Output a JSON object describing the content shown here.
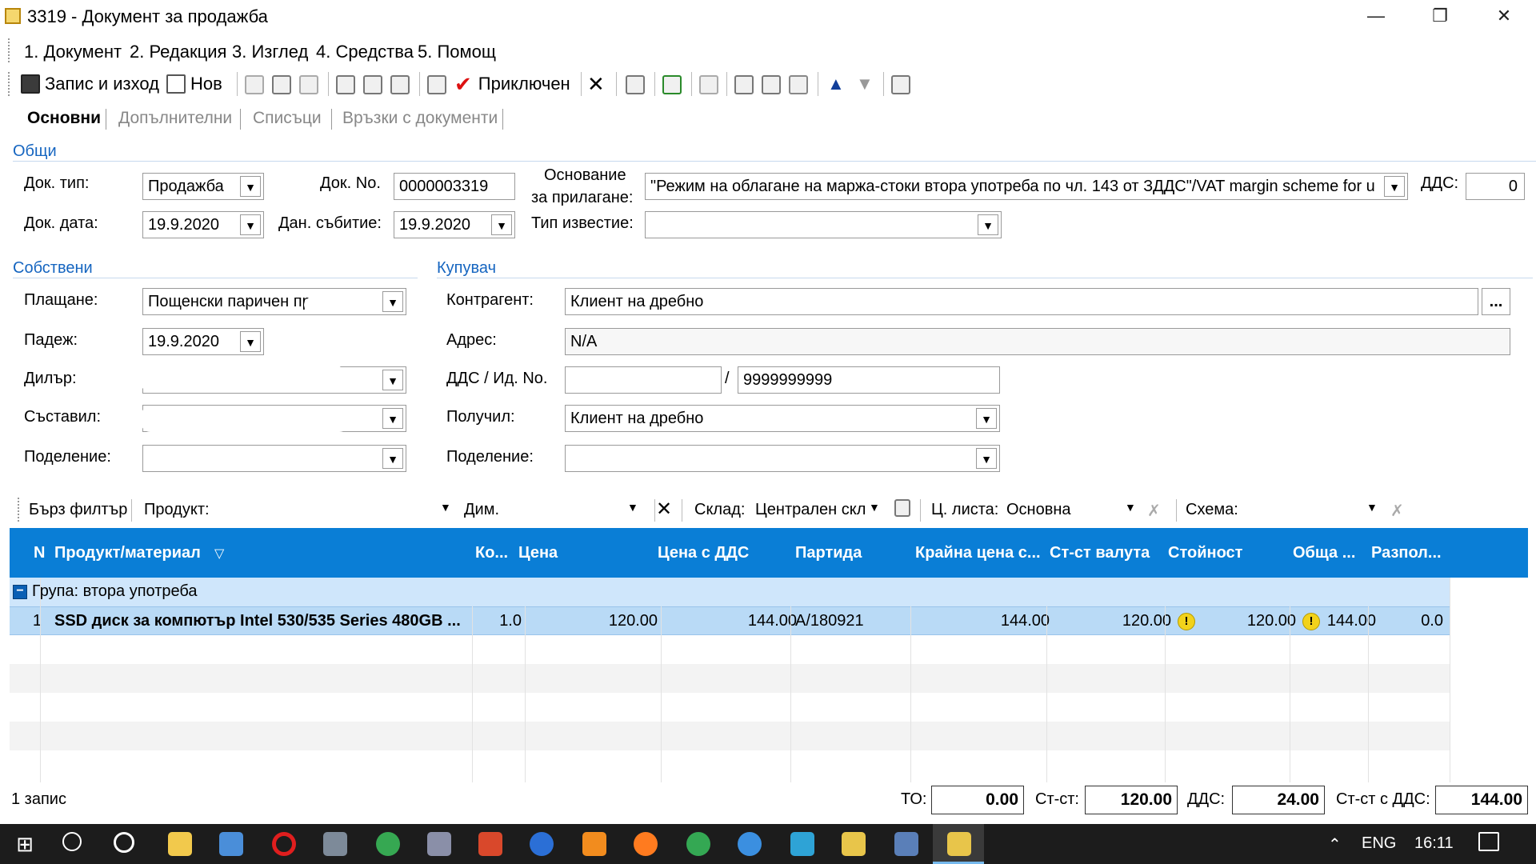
{
  "window": {
    "title": "3319 - Документ за продажба"
  },
  "menu": [
    "1. Документ",
    "2. Редакция",
    "3. Изглед",
    "4. Средства",
    "5. Помощ"
  ],
  "toolbar": {
    "save_exit": "Запис и изход",
    "new": "Нов",
    "completed": "Приключен"
  },
  "tabs": [
    "Основни",
    "Допълнителни",
    "Списъци",
    "Връзки с документи"
  ],
  "general": {
    "section": "Общи",
    "doc_type_label": "Док. тип:",
    "doc_type": "Продажба",
    "doc_no_label": "Док. No.",
    "doc_no": "0000003319",
    "basis_label_1": "Основание",
    "basis_label_2": "за прилагане:",
    "basis": "\"Режим на облагане на маржа-стоки втора употреба по чл. 143 от ЗДДС\"/VAT margin scheme for u",
    "vat_label": "ДДС:",
    "vat": "0",
    "doc_date_label": "Док. дата:",
    "doc_date": "19.9.2020",
    "tax_event_label": "Дан. събитие:",
    "tax_event": "19.9.2020",
    "notice_type_label": "Тип известие:",
    "notice_type": ""
  },
  "own": {
    "section": "Собствени",
    "payment_label": "Плащане:",
    "payment": "Пощенски паричен превод",
    "due_label": "Падеж:",
    "due": "19.9.2020",
    "dealer_label": "Дилър:",
    "dealer": "",
    "compiler_label": "Съставил:",
    "compiler": "",
    "division_label": "Поделение:",
    "division": ""
  },
  "buyer": {
    "section": "Купувач",
    "partner_label": "Контрагент:",
    "partner": "Клиент на дребно",
    "partner_btn": "...",
    "address_label": "Адрес:",
    "address": "N/A",
    "vat_id_label": "ДДС / Ид. No.",
    "vat_no": "",
    "id_no": "9999999999",
    "sep": "/",
    "received_label": "Получил:",
    "received": "Клиент на дребно",
    "division_label": "Поделение:",
    "division": ""
  },
  "filter": {
    "quick": "Бърз филтър",
    "product_label": "Продукт:",
    "product": "",
    "dim_label": "Дим.",
    "dim": "",
    "warehouse_label": "Склад:",
    "warehouse": "Централен скл",
    "pricelist_label": "Ц. листа:",
    "pricelist": "Основна",
    "scheme_label": "Схема:",
    "scheme": ""
  },
  "grid": {
    "columns": [
      "N",
      "Продукт/материал",
      "Ко...",
      "Цена",
      "Цена с ДДС",
      "Партида",
      "Крайна цена с...",
      "Ст-ст валута",
      "Стойност",
      "Обща ...",
      "Разпол..."
    ],
    "group": "Група: втора употреба",
    "rows": [
      {
        "n": "1",
        "product": "SSD диск за компютър Intel 530/535 Series 480GB ...",
        "qty": "1.0",
        "price": "120.00",
        "price_vat": "144.00",
        "batch": "A/180921",
        "final_price": "144.00",
        "value_currency": "120.00",
        "value": "120.00",
        "total": "144.00",
        "available": "0.0"
      }
    ]
  },
  "status": {
    "records": "1 запис",
    "to_label": "ТО:",
    "to": "0.00",
    "value_label": "Ст-ст:",
    "value": "120.00",
    "vat_label": "ДДС:",
    "vat": "24.00",
    "value_vat_label": "Ст-ст с ДДС:",
    "value_vat": "144.00"
  },
  "taskbar": {
    "lang": "ENG",
    "time": "16:11"
  }
}
